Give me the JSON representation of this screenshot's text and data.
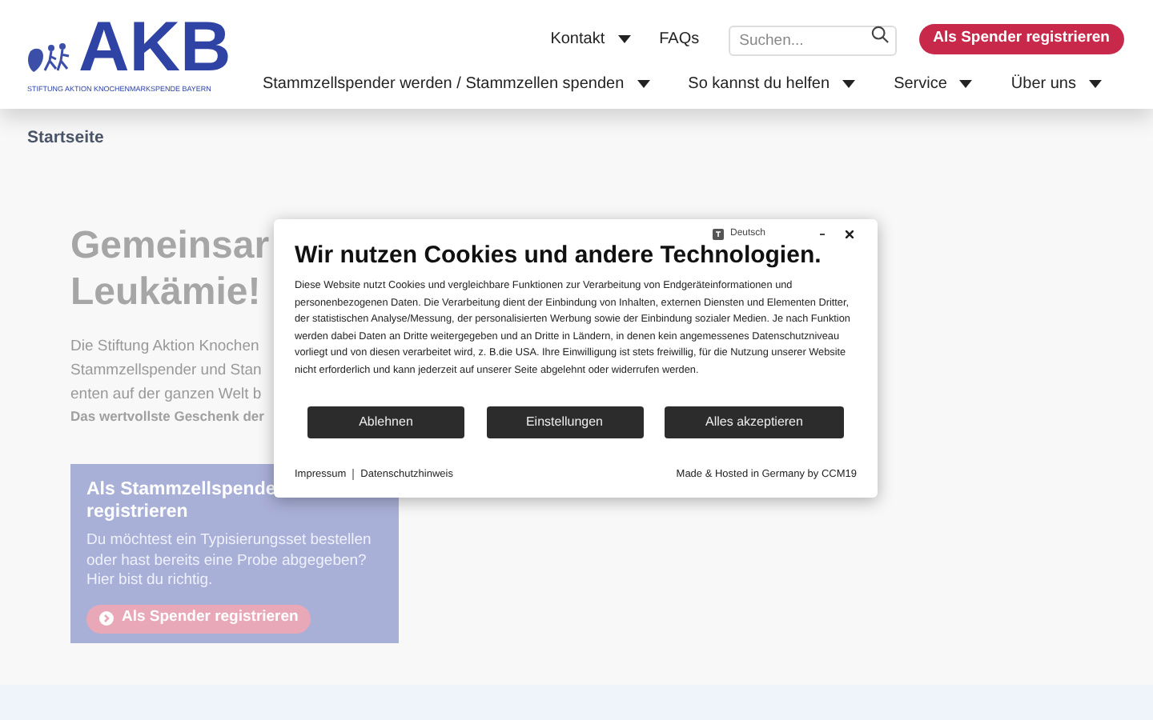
{
  "header": {
    "logo_text": "AKB",
    "logo_subtitle": "STIFTUNG AKTION KNOCHENMARKSPENDE BAYERN",
    "top_links": [
      {
        "label": "Kontakt",
        "dropdown": true
      },
      {
        "label": "FAQs",
        "dropdown": false
      }
    ],
    "search": {
      "placeholder": "Suchen..."
    },
    "register_button": "Als Spender registrieren",
    "nav": [
      {
        "label": "Stammzellspender werden / Stammzellen spenden"
      },
      {
        "label": "So kannst du helfen"
      },
      {
        "label": "Service"
      },
      {
        "label": "Über uns"
      }
    ]
  },
  "breadcrumb": "Startseite",
  "hero": {
    "title_lines": [
      "Gemeinsar",
      "Leukämie!"
    ],
    "text_lines": [
      "Die Stiftung Aktion Knochen",
      "Stammzellspender und Stan",
      "enten auf der ganzen Welt b"
    ],
    "bold_line": "Das wertvollste Geschenk der"
  },
  "card": {
    "title_lines": [
      "Als Stammzellspende",
      "registrieren"
    ],
    "text": "Du möchtest ein Typisierungsset bestellen oder hast bereits eine Probe abgegeben? Hier bist du richtig.",
    "button": "Als Spender registrieren"
  },
  "cookie_dialog": {
    "language": "Deutsch",
    "title": "Wir nutzen Cookies und andere Technologien.",
    "text": "Diese Website nutzt Cookies und vergleichbare Funktionen zur Verarbeitung von Endgeräteinformationen und personenbezogenen Daten. Die Verarbeitung dient der Einbindung von Inhalten, externen Diensten und Elementen Dritter, der statistischen Analyse/Messung, der personalisierten Werbung sowie der Einbindung sozialer Medien. Je nach Funktion werden dabei Daten an Dritte weitergegeben und an Dritte in Ländern, in denen kein angemessenes Datenschutzniveau vorliegt und von diesen verarbeitet wird, z. B.die USA. Ihre Einwilligung ist stets freiwillig, für die Nutzung unserer Website nicht erforderlich und kann jederzeit auf unserer Seite abgelehnt oder widerrufen werden.",
    "buttons": [
      "Ablehnen",
      "Einstellungen",
      "Alles akzeptieren"
    ],
    "footer_links": [
      "Impressum",
      "Datenschutzhinweis"
    ],
    "credit": "Made & Hosted in Germany by CCM19"
  }
}
